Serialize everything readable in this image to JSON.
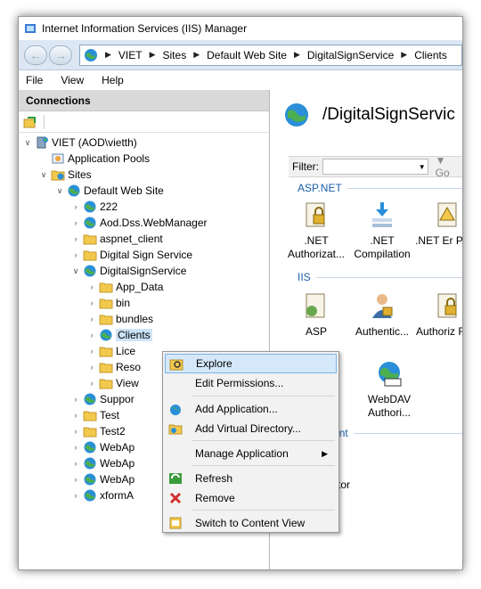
{
  "window": {
    "title": "Internet Information Services (IIS) Manager"
  },
  "address": {
    "back_glyph": "←",
    "forward_glyph": "→",
    "separator_glyph": "▶",
    "path": [
      "VIET",
      "Sites",
      "Default Web Site",
      "DigitalSignService",
      "Clients"
    ]
  },
  "menu": {
    "file": "File",
    "view": "View",
    "help": "Help"
  },
  "connections": {
    "title": "Connections",
    "tree": [
      {
        "label": "VIET (AOD\\vietth)",
        "level": 0,
        "expander": "expanded",
        "icon": "server-icon"
      },
      {
        "label": "Application Pools",
        "level": 1,
        "expander": "none",
        "icon": "app-pools-icon"
      },
      {
        "label": "Sites",
        "level": 1,
        "expander": "expanded",
        "icon": "sites-icon"
      },
      {
        "label": "Default Web Site",
        "level": 2,
        "expander": "expanded",
        "icon": "globe-icon"
      },
      {
        "label": "222",
        "level": 3,
        "expander": "collapsed",
        "icon": "web-app-icon"
      },
      {
        "label": "Aod.Dss.WebManager",
        "level": 3,
        "expander": "collapsed",
        "icon": "web-app-icon"
      },
      {
        "label": "aspnet_client",
        "level": 3,
        "expander": "collapsed",
        "icon": "folder-icon"
      },
      {
        "label": "Digital Sign Service",
        "level": 3,
        "expander": "collapsed",
        "icon": "folder-icon"
      },
      {
        "label": "DigitalSignService",
        "level": 3,
        "expander": "expanded",
        "icon": "web-app-icon"
      },
      {
        "label": "App_Data",
        "level": 4,
        "expander": "collapsed",
        "icon": "folder-icon"
      },
      {
        "label": "bin",
        "level": 4,
        "expander": "collapsed",
        "icon": "folder-icon"
      },
      {
        "label": "bundles",
        "level": 4,
        "expander": "collapsed",
        "icon": "folder-icon"
      },
      {
        "label": "Clients",
        "level": 4,
        "expander": "collapsed",
        "icon": "web-app-icon",
        "selected": true
      },
      {
        "label": "Lice",
        "level": 4,
        "expander": "collapsed",
        "icon": "folder-icon"
      },
      {
        "label": "Reso",
        "level": 4,
        "expander": "collapsed",
        "icon": "folder-icon"
      },
      {
        "label": "View",
        "level": 4,
        "expander": "collapsed",
        "icon": "folder-icon"
      },
      {
        "label": "Suppor",
        "level": 3,
        "expander": "collapsed",
        "icon": "web-app-icon"
      },
      {
        "label": "Test",
        "level": 3,
        "expander": "collapsed",
        "icon": "folder-icon"
      },
      {
        "label": "Test2",
        "level": 3,
        "expander": "collapsed",
        "icon": "folder-icon"
      },
      {
        "label": "WebAp",
        "level": 3,
        "expander": "collapsed",
        "icon": "web-app-icon"
      },
      {
        "label": "WebAp",
        "level": 3,
        "expander": "collapsed",
        "icon": "web-app-icon"
      },
      {
        "label": "WebAp",
        "level": 3,
        "expander": "collapsed",
        "icon": "web-app-icon"
      },
      {
        "label": "xformA",
        "level": 3,
        "expander": "collapsed",
        "icon": "web-app-icon"
      }
    ]
  },
  "content": {
    "title": "/DigitalSignServic",
    "filter": {
      "label": "Filter:",
      "go": "Go"
    },
    "groups": [
      {
        "name": "ASP.NET",
        "features": [
          {
            "label": ".NET Authorizat...",
            "icon": "dotnet-authorization-icon"
          },
          {
            "label": ".NET Compilation",
            "icon": "dotnet-compilation-icon"
          },
          {
            "label": ".NET Er Page",
            "icon": "dotnet-error-pages-icon"
          }
        ]
      },
      {
        "name": "IIS",
        "features": [
          {
            "label": "ASP",
            "icon": "asp-icon"
          },
          {
            "label": "Authentic...",
            "icon": "authentication-icon"
          },
          {
            "label": "Authoriz Rule",
            "icon": "authorization-rules-icon"
          },
          {
            "label": "ettings",
            "icon": "settings-icon"
          },
          {
            "label": "WebDAV Authori...",
            "icon": "webdav-icon"
          }
        ]
      },
      {
        "name": "agement",
        "features": [
          {
            "label": "igurat... itor",
            "icon": "configuration-editor-icon"
          }
        ]
      }
    ]
  },
  "context_menu": {
    "items": [
      {
        "label": "Explore",
        "icon": "explore-icon",
        "highlighted": true
      },
      {
        "label": "Edit Permissions...",
        "icon": ""
      },
      {
        "label": "Add Application...",
        "icon": "add-application-icon"
      },
      {
        "label": "Add Virtual Directory...",
        "icon": "add-virtual-directory-icon"
      },
      {
        "label": "Manage Application",
        "icon": "",
        "submenu": true
      },
      {
        "label": "Refresh",
        "icon": "refresh-icon"
      },
      {
        "label": "Remove",
        "icon": "remove-icon"
      },
      {
        "label": "Switch to Content View",
        "icon": "content-view-icon"
      }
    ]
  },
  "colors": {
    "address_bar": "#dce7f3",
    "group_header": "#1a5fa8",
    "selection": "#cce4f7",
    "menu_highlight": "#d5e8fa",
    "folder": "#f2c94c"
  }
}
